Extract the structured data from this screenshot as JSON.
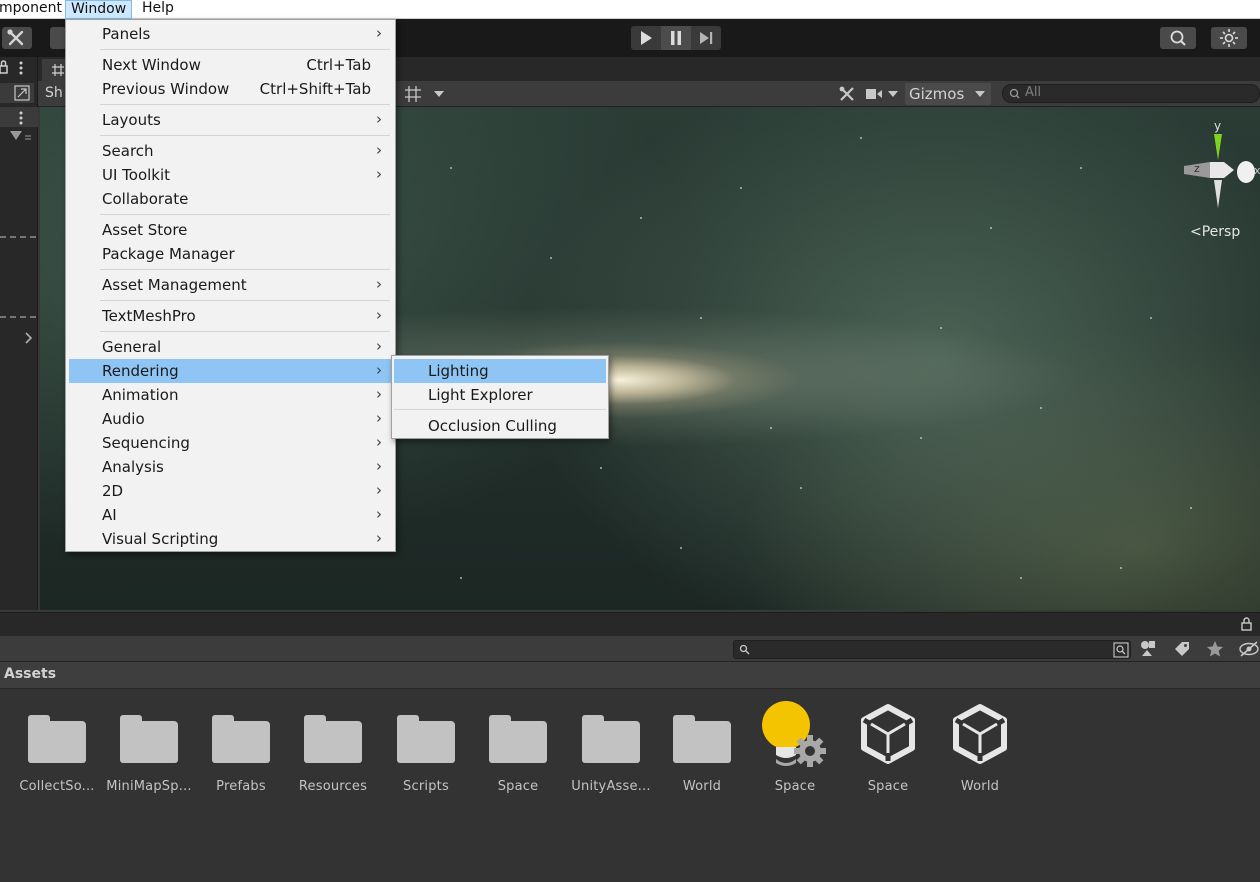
{
  "menubar": {
    "items": [
      {
        "label": "mponent"
      },
      {
        "label": "Window"
      },
      {
        "label": "Help"
      }
    ]
  },
  "toolbar": {
    "play_icon": "play-icon",
    "pause_icon": "pause-icon",
    "step_icon": "step-icon"
  },
  "scene": {
    "tab_label": "Sh",
    "gizmos_label": "Gizmos",
    "search_placeholder": "All",
    "persp_label": "<Persp",
    "gizmo_axes": {
      "y": "y",
      "x": "x",
      "z": "z"
    }
  },
  "window_menu": {
    "items": [
      {
        "label": "Panels",
        "shortcut": "",
        "submenu": true
      },
      {
        "label": "Next Window",
        "shortcut": "Ctrl+Tab",
        "submenu": false
      },
      {
        "label": "Previous Window",
        "shortcut": "Ctrl+Shift+Tab",
        "submenu": false
      },
      {
        "label": "Layouts",
        "shortcut": "",
        "submenu": true
      },
      {
        "label": "Search",
        "shortcut": "",
        "submenu": true
      },
      {
        "label": "UI Toolkit",
        "shortcut": "",
        "submenu": true
      },
      {
        "label": "Collaborate",
        "shortcut": "",
        "submenu": false
      },
      {
        "label": "Asset Store",
        "shortcut": "",
        "submenu": false
      },
      {
        "label": "Package Manager",
        "shortcut": "",
        "submenu": false
      },
      {
        "label": "Asset Management",
        "shortcut": "",
        "submenu": true
      },
      {
        "label": "TextMeshPro",
        "shortcut": "",
        "submenu": true
      },
      {
        "label": "General",
        "shortcut": "",
        "submenu": true
      },
      {
        "label": "Rendering",
        "shortcut": "",
        "submenu": true
      },
      {
        "label": "Animation",
        "shortcut": "",
        "submenu": true
      },
      {
        "label": "Audio",
        "shortcut": "",
        "submenu": true
      },
      {
        "label": "Sequencing",
        "shortcut": "",
        "submenu": true
      },
      {
        "label": "Analysis",
        "shortcut": "",
        "submenu": true
      },
      {
        "label": "2D",
        "shortcut": "",
        "submenu": true
      },
      {
        "label": "AI",
        "shortcut": "",
        "submenu": true
      },
      {
        "label": "Visual Scripting",
        "shortcut": "",
        "submenu": true
      }
    ],
    "highlighted": "Rendering"
  },
  "rendering_submenu": {
    "items": [
      {
        "label": "Lighting"
      },
      {
        "label": "Light Explorer"
      },
      {
        "label": "Occlusion Culling"
      }
    ],
    "highlighted": "Lighting"
  },
  "project": {
    "title": "Assets",
    "assets": [
      {
        "label": "CollectSo...",
        "kind": "folder"
      },
      {
        "label": "MiniMapSp...",
        "kind": "folder"
      },
      {
        "label": "Prefabs",
        "kind": "folder"
      },
      {
        "label": "Resources",
        "kind": "folder"
      },
      {
        "label": "Scripts",
        "kind": "folder"
      },
      {
        "label": "Space",
        "kind": "folder"
      },
      {
        "label": "UnityAsse...",
        "kind": "folder"
      },
      {
        "label": "World",
        "kind": "folder"
      },
      {
        "label": "Space",
        "kind": "lighting-settings"
      },
      {
        "label": "Space",
        "kind": "unity-scene"
      },
      {
        "label": "World",
        "kind": "unity-scene"
      }
    ]
  },
  "colors": {
    "menu_highlight": "#8ec5f5",
    "folder": "#c2c2c2",
    "lighting_bulb": "#f5c400"
  }
}
